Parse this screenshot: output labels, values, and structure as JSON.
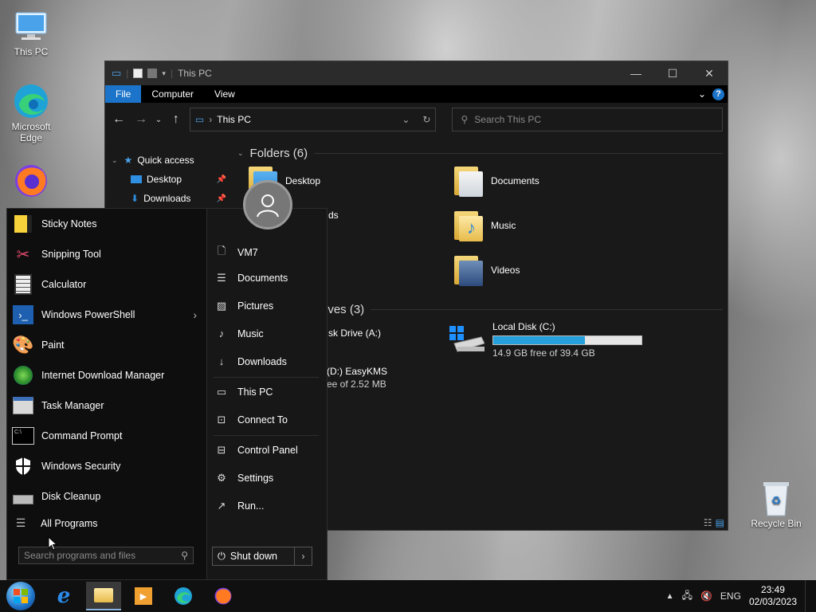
{
  "desktop": {
    "icons": [
      {
        "label": "This PC"
      },
      {
        "label": "Microsoft Edge"
      },
      {
        "label": "Recycle Bin"
      }
    ]
  },
  "explorer": {
    "title": "This PC",
    "ribbon_tabs": [
      "File",
      "Computer",
      "View"
    ],
    "address": "This PC",
    "search_placeholder": "Search This PC",
    "nav": {
      "quick_access": "Quick access",
      "items": [
        "Desktop",
        "Downloads"
      ]
    },
    "folders_header": "Folders (6)",
    "folders": [
      "Desktop",
      "Documents",
      "Downloads",
      "Music",
      "Videos"
    ],
    "folders_partial": {
      "downloads_visible": "ds"
    },
    "drives_header_visible": "ives (3)",
    "drives": {
      "a_visible": "sk Drive (A:)",
      "d_visible": "(D:) EasyKMS",
      "d_free_visible": "ee of 2.52 MB",
      "c_name": "Local Disk (C:)",
      "c_free": "14.9 GB free of 39.4 GB",
      "c_used_fraction": 0.62
    }
  },
  "startmenu": {
    "programs": [
      {
        "label": "Sticky Notes",
        "icon": "sticky-notes-icon"
      },
      {
        "label": "Snipping Tool",
        "icon": "snipping-tool-icon"
      },
      {
        "label": "Calculator",
        "icon": "calculator-icon"
      },
      {
        "label": "Windows PowerShell",
        "icon": "powershell-icon",
        "submenu": true
      },
      {
        "label": "Paint",
        "icon": "paint-icon"
      },
      {
        "label": "Internet Download Manager",
        "icon": "idm-icon"
      },
      {
        "label": "Task Manager",
        "icon": "task-manager-icon"
      },
      {
        "label": "Command Prompt",
        "icon": "cmd-icon"
      },
      {
        "label": "Windows Security",
        "icon": "shield-icon"
      },
      {
        "label": "Disk Cleanup",
        "icon": "disk-cleanup-icon"
      }
    ],
    "all_programs": "All Programs",
    "search_placeholder": "Search programs and files",
    "right": {
      "user": "VM7",
      "documents": "Documents",
      "pictures": "Pictures",
      "music": "Music",
      "downloads": "Downloads",
      "this_pc": "This PC",
      "connect_to": "Connect To",
      "control_panel": "Control Panel",
      "settings": "Settings",
      "run": "Run..."
    },
    "shutdown": "Shut down"
  },
  "taskbar": {
    "language": "ENG",
    "time": "23:49",
    "date": "02/03/2023"
  },
  "colors": {
    "accent": "#1b74c9",
    "drive_fill": "#26a0da"
  }
}
